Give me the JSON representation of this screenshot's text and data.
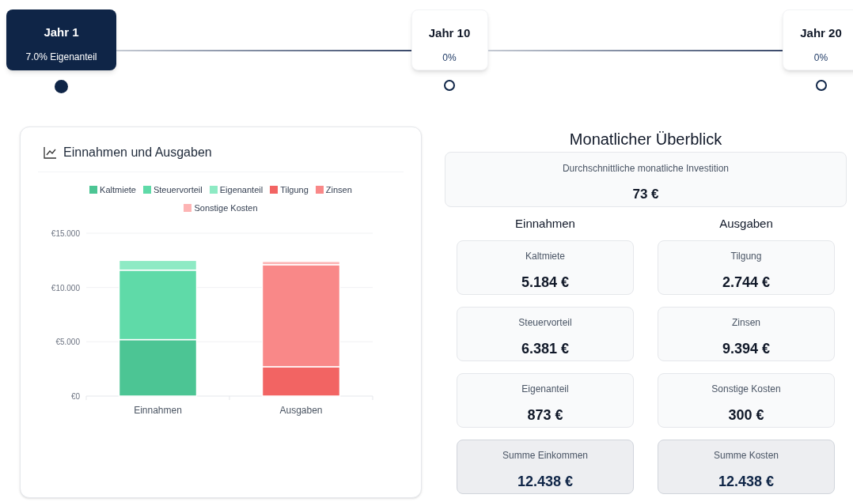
{
  "timeline": [
    {
      "title": "Jahr 1",
      "subtitle": "7.0% Eigenanteil",
      "selected": true
    },
    {
      "title": "Jahr 10",
      "subtitle": "0%",
      "selected": false
    },
    {
      "title": "Jahr 20",
      "subtitle": "0%",
      "selected": false
    }
  ],
  "chart_card": {
    "title": "Einnahmen und Ausgaben",
    "chart_data": {
      "type": "bar",
      "stacked": true,
      "categories": [
        "Einnahmen",
        "Ausgaben"
      ],
      "ylim": [
        0,
        15
      ],
      "yticks": [
        {
          "value": 0,
          "label": "€0"
        },
        {
          "value": 5,
          "label": "€5.000"
        },
        {
          "value": 10,
          "label": "€10.000"
        },
        {
          "value": 15,
          "label": "€15.000"
        }
      ],
      "series": [
        {
          "name": "Kaltmiete",
          "color": "#4cc594",
          "values": [
            5.2,
            null
          ]
        },
        {
          "name": "Steuervorteil",
          "color": "#5fdaa8",
          "values": [
            6.4,
            null
          ]
        },
        {
          "name": "Eigenanteil",
          "color": "#8eeac4",
          "values": [
            0.9,
            null
          ]
        },
        {
          "name": "Tilgung",
          "color": "#f26463",
          "values": [
            null,
            2.7
          ]
        },
        {
          "name": "Zinsen",
          "color": "#f98888",
          "values": [
            null,
            9.4
          ]
        },
        {
          "name": "Sonstige Kosten",
          "color": "#fdb4b4",
          "values": [
            null,
            0.3
          ]
        }
      ]
    }
  },
  "overview": {
    "title": "Monatlicher Überblick",
    "average": {
      "label": "Durchschnittliche monatliche Investition",
      "value": "73 €"
    },
    "columns": [
      {
        "heading": "Einnahmen",
        "items": [
          {
            "kind": "item",
            "label": "Kaltmiete",
            "value": "5.184 €"
          },
          {
            "kind": "item",
            "label": "Steuervorteil",
            "value": "6.381 €"
          },
          {
            "kind": "item",
            "label": "Eigenanteil",
            "value": "873 €"
          },
          {
            "kind": "total",
            "label": "Summe Einkommen",
            "value": "12.438 €"
          }
        ]
      },
      {
        "heading": "Ausgaben",
        "items": [
          {
            "kind": "item",
            "label": "Tilgung",
            "value": "2.744 €"
          },
          {
            "kind": "item",
            "label": "Zinsen",
            "value": "9.394 €"
          },
          {
            "kind": "item",
            "label": "Sonstige Kosten",
            "value": "300 €"
          },
          {
            "kind": "total",
            "label": "Summe Kosten",
            "value": "12.438 €"
          }
        ]
      }
    ]
  }
}
